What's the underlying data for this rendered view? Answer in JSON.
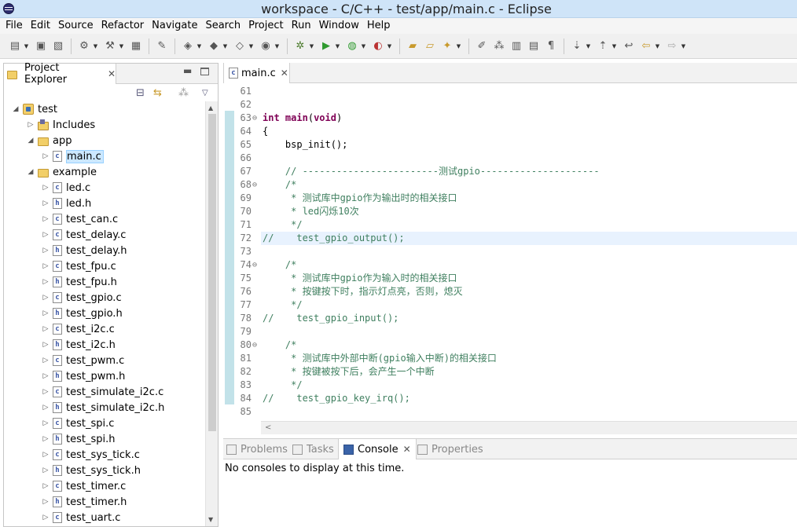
{
  "window": {
    "title": "workspace - C/C++ - test/app/main.c - Eclipse"
  },
  "menu": [
    "File",
    "Edit",
    "Source",
    "Refactor",
    "Navigate",
    "Search",
    "Project",
    "Run",
    "Window",
    "Help"
  ],
  "explorer": {
    "tab_label": "Project Explorer",
    "close_glyph": "✕",
    "tree": [
      {
        "label": "test",
        "type": "project",
        "expanded": true,
        "depth": 0
      },
      {
        "label": "Includes",
        "type": "includes",
        "expanded": false,
        "depth": 1
      },
      {
        "label": "app",
        "type": "folder",
        "expanded": true,
        "depth": 1
      },
      {
        "label": "main.c",
        "type": "c",
        "expanded": false,
        "depth": 2,
        "selected": true
      },
      {
        "label": "example",
        "type": "folder",
        "expanded": true,
        "depth": 1
      },
      {
        "label": "led.c",
        "type": "c",
        "depth": 2
      },
      {
        "label": "led.h",
        "type": "h",
        "depth": 2
      },
      {
        "label": "test_can.c",
        "type": "c",
        "depth": 2
      },
      {
        "label": "test_delay.c",
        "type": "c",
        "depth": 2
      },
      {
        "label": "test_delay.h",
        "type": "h",
        "depth": 2
      },
      {
        "label": "test_fpu.c",
        "type": "c",
        "depth": 2
      },
      {
        "label": "test_fpu.h",
        "type": "h",
        "depth": 2
      },
      {
        "label": "test_gpio.c",
        "type": "c",
        "depth": 2
      },
      {
        "label": "test_gpio.h",
        "type": "h",
        "depth": 2
      },
      {
        "label": "test_i2c.c",
        "type": "c",
        "depth": 2
      },
      {
        "label": "test_i2c.h",
        "type": "h",
        "depth": 2
      },
      {
        "label": "test_pwm.c",
        "type": "c",
        "depth": 2
      },
      {
        "label": "test_pwm.h",
        "type": "h",
        "depth": 2
      },
      {
        "label": "test_simulate_i2c.c",
        "type": "c",
        "depth": 2
      },
      {
        "label": "test_simulate_i2c.h",
        "type": "h",
        "depth": 2
      },
      {
        "label": "test_spi.c",
        "type": "c",
        "depth": 2
      },
      {
        "label": "test_spi.h",
        "type": "h",
        "depth": 2
      },
      {
        "label": "test_sys_tick.c",
        "type": "c",
        "depth": 2
      },
      {
        "label": "test_sys_tick.h",
        "type": "h",
        "depth": 2
      },
      {
        "label": "test_timer.c",
        "type": "c",
        "depth": 2
      },
      {
        "label": "test_timer.h",
        "type": "h",
        "depth": 2
      },
      {
        "label": "test_uart.c",
        "type": "c",
        "depth": 2
      }
    ]
  },
  "editor": {
    "tab_label": "main.c",
    "current_line": 72,
    "lines": [
      {
        "n": "61",
        "fold": "",
        "segs": []
      },
      {
        "n": "62",
        "fold": "",
        "segs": []
      },
      {
        "n": "63",
        "fold": "⊖",
        "segs": [
          {
            "t": "int",
            "c": "kw"
          },
          {
            "t": " "
          },
          {
            "t": "main",
            "c": "kw"
          },
          {
            "t": "("
          },
          {
            "t": "void",
            "c": "kw"
          },
          {
            "t": ")"
          }
        ]
      },
      {
        "n": "64",
        "fold": "",
        "segs": [
          {
            "t": "{"
          }
        ]
      },
      {
        "n": "65",
        "fold": "",
        "segs": [
          {
            "t": "    bsp_init();"
          }
        ]
      },
      {
        "n": "66",
        "fold": "",
        "segs": []
      },
      {
        "n": "67",
        "fold": "",
        "segs": [
          {
            "t": "    // ------------------------测试gpio---------------------",
            "c": "cm"
          }
        ]
      },
      {
        "n": "68",
        "fold": "⊖",
        "segs": [
          {
            "t": "    /*",
            "c": "cm"
          }
        ]
      },
      {
        "n": "69",
        "fold": "",
        "segs": [
          {
            "t": "     * 测试库中gpio作为输出时的相关接口",
            "c": "cm"
          }
        ]
      },
      {
        "n": "70",
        "fold": "",
        "segs": [
          {
            "t": "     * led闪烁10次",
            "c": "cm"
          }
        ]
      },
      {
        "n": "71",
        "fold": "",
        "segs": [
          {
            "t": "     */",
            "c": "cm"
          }
        ]
      },
      {
        "n": "72",
        "fold": "",
        "segs": [
          {
            "t": "//    test_gpio_output();",
            "c": "cm"
          }
        ]
      },
      {
        "n": "73",
        "fold": "",
        "segs": []
      },
      {
        "n": "74",
        "fold": "⊖",
        "segs": [
          {
            "t": "    /*",
            "c": "cm"
          }
        ]
      },
      {
        "n": "75",
        "fold": "",
        "segs": [
          {
            "t": "     * 测试库中gpio作为输入时的相关接口",
            "c": "cm"
          }
        ]
      },
      {
        "n": "76",
        "fold": "",
        "segs": [
          {
            "t": "     * 按键按下时，指示灯点亮，否则，熄灭",
            "c": "cm"
          }
        ]
      },
      {
        "n": "77",
        "fold": "",
        "segs": [
          {
            "t": "     */",
            "c": "cm"
          }
        ]
      },
      {
        "n": "78",
        "fold": "",
        "segs": [
          {
            "t": "//    test_gpio_input();",
            "c": "cm"
          }
        ]
      },
      {
        "n": "79",
        "fold": "",
        "segs": []
      },
      {
        "n": "80",
        "fold": "⊖",
        "segs": [
          {
            "t": "    /*",
            "c": "cm"
          }
        ]
      },
      {
        "n": "81",
        "fold": "",
        "segs": [
          {
            "t": "     * 测试库中外部中断(gpio输入中断)的相关接口",
            "c": "cm"
          }
        ]
      },
      {
        "n": "82",
        "fold": "",
        "segs": [
          {
            "t": "     * 按键被按下后，会产生一个中断",
            "c": "cm"
          }
        ]
      },
      {
        "n": "83",
        "fold": "",
        "segs": [
          {
            "t": "     */",
            "c": "cm"
          }
        ]
      },
      {
        "n": "84",
        "fold": "",
        "segs": [
          {
            "t": "//    test_gpio_key_irq();",
            "c": "cm"
          }
        ]
      },
      {
        "n": "85",
        "fold": "",
        "segs": []
      }
    ]
  },
  "bottom": {
    "tabs": [
      {
        "id": "problems",
        "label": "Problems"
      },
      {
        "id": "tasks",
        "label": "Tasks"
      },
      {
        "id": "console",
        "label": "Console"
      },
      {
        "id": "properties",
        "label": "Properties"
      }
    ],
    "console_message": "No consoles to display at this time."
  },
  "colors": {
    "keyword": "#7f0055",
    "comment": "#3f7f5f",
    "selection": "#cce8ff",
    "current_line": "#e8f2fe"
  }
}
